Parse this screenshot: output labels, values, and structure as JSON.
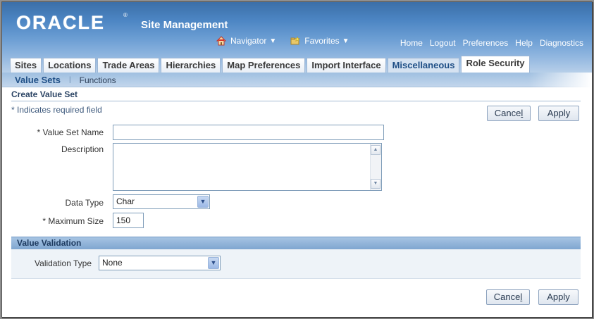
{
  "header": {
    "logo": "ORACLE",
    "logo_mark": "®",
    "app_title": "Site Management",
    "navigator_label": "Navigator",
    "favorites_label": "Favorites",
    "global_links": [
      "Home",
      "Logout",
      "Preferences",
      "Help",
      "Diagnostics"
    ]
  },
  "tabs": [
    {
      "label": "Sites"
    },
    {
      "label": "Locations"
    },
    {
      "label": "Trade Areas"
    },
    {
      "label": "Hierarchies"
    },
    {
      "label": "Map Preferences"
    },
    {
      "label": "Import Interface"
    },
    {
      "label": "Miscellaneous"
    },
    {
      "label": "Role Security"
    }
  ],
  "subtabs": {
    "active": "Value Sets",
    "separator": "|",
    "other": "Functions"
  },
  "page": {
    "title": "Create Value Set",
    "required_note": "* Indicates required field",
    "cancel_label": "Cancel",
    "cancel_access_key": "l",
    "apply_label": "Apply"
  },
  "form": {
    "value_set_name_label": "* Value Set Name",
    "value_set_name_value": "",
    "description_label": "Description",
    "description_value": "",
    "data_type_label": "Data Type",
    "data_type_value": "Char",
    "maximum_size_label": "* Maximum Size",
    "maximum_size_value": "150"
  },
  "validation": {
    "section_title": "Value Validation",
    "validation_type_label": "Validation Type",
    "validation_type_value": "None"
  },
  "colors": {
    "header_blue": "#4d86c4",
    "section_blue": "#7fa6d0",
    "active_tab_text": "#1f4f86"
  },
  "icons": {
    "navigator": "house-icon",
    "favorites": "folder-star-icon",
    "dropdown": "chevron-down-icon"
  }
}
